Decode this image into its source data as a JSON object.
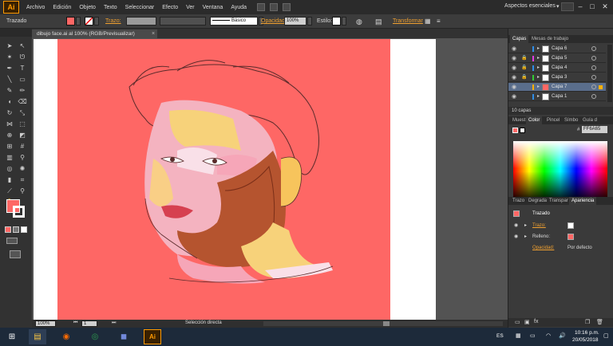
{
  "app": {
    "logo": "Ai",
    "menu": [
      "Archivo",
      "Edición",
      "Objeto",
      "Texto",
      "Seleccionar",
      "Efecto",
      "Ver",
      "Ventana",
      "Ayuda"
    ],
    "workspace": "Aspectos esenciales",
    "window_buttons": [
      "–",
      "□",
      "✕"
    ]
  },
  "control_bar": {
    "object_label": "Trazado",
    "stroke_label": "Trazo:",
    "brush_preset": "Básico",
    "opacity_label": "Opacidad:",
    "opacity_value": "100%",
    "style_label": "Estilo:",
    "transform_label": "Transformar",
    "fill_color": "#fe6765"
  },
  "document": {
    "tab_title": "dibujo face.ai al 100% (RGB/Previsualizar)",
    "artboard_bg": "#fe6765"
  },
  "status_bar": {
    "zoom": "100%",
    "page": "1",
    "tool_status": "Selección directa"
  },
  "layers_panel": {
    "tabs": [
      "Capas",
      "Mesas de trabajo"
    ],
    "layers": [
      {
        "name": "Capa 6",
        "color": "#2e8de8",
        "selected": false
      },
      {
        "name": "Capa 5",
        "color": "#e13ce1",
        "selected": false
      },
      {
        "name": "Capa 4",
        "color": "#2e8de8",
        "selected": false
      },
      {
        "name": "Capa 3",
        "color": "#33cc33",
        "selected": false
      },
      {
        "name": "Capa 7",
        "color": "#ffb000",
        "selected": true
      },
      {
        "name": "Capa 1",
        "color": "#2e8de8",
        "selected": false
      }
    ],
    "footer_count": "10 capas"
  },
  "color_panel": {
    "tabs": [
      "Muest",
      "Color",
      "Pincel",
      "Símbo",
      "Guía d"
    ],
    "hex_value": "FF6A65"
  },
  "appearance_panel": {
    "tabs": [
      "Trazo",
      "Degrada",
      "Transpar",
      "Apariencia"
    ],
    "title": "Trazado",
    "rows": [
      {
        "label": "Trazo:",
        "value": ""
      },
      {
        "label": "Relleno:",
        "value": ""
      },
      {
        "label": "Opacidad:",
        "value": "Por defecto"
      }
    ],
    "footer_icons": "fx"
  },
  "taskbar": {
    "language": "ES",
    "time": "10:16 p.m.",
    "date": "20/05/2018",
    "apps": [
      "file-explorer-icon",
      "firefox-icon",
      "chrome-icon",
      "discord-icon",
      "illustrator-icon"
    ]
  }
}
